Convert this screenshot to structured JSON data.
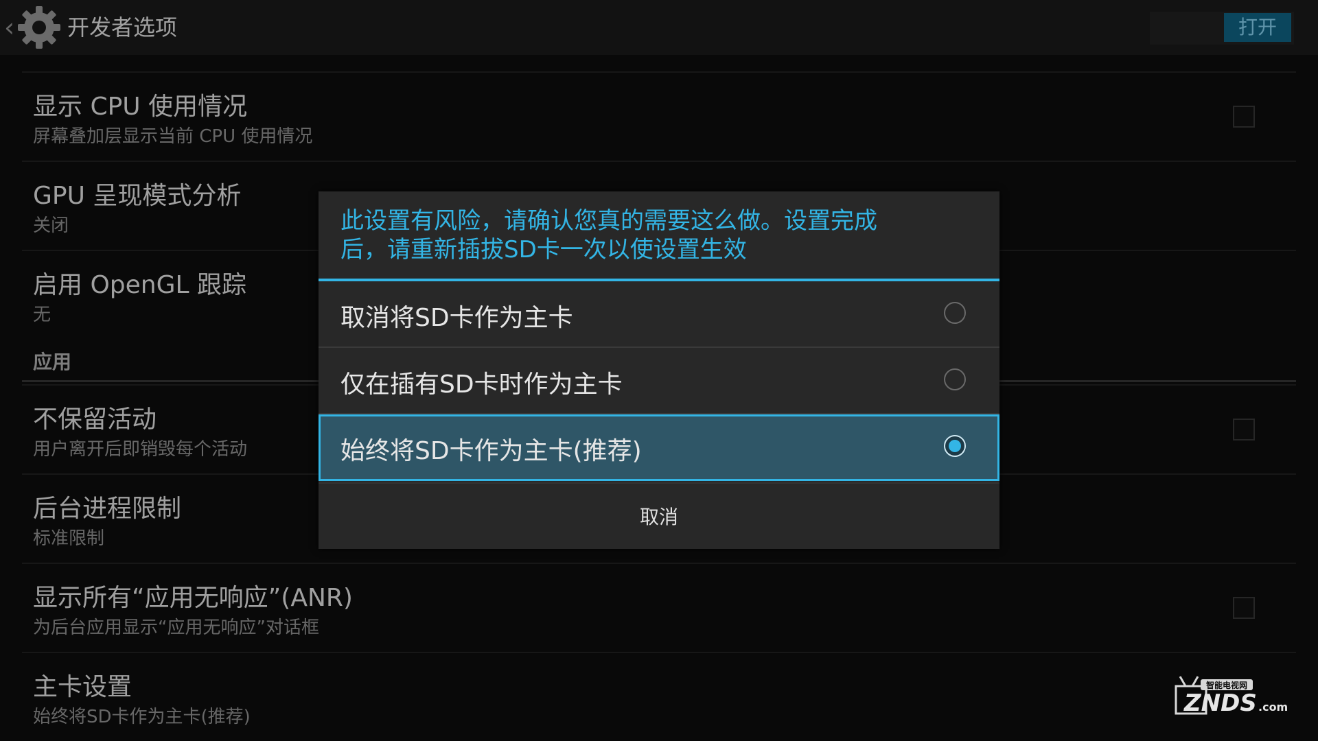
{
  "action_bar": {
    "title": "开发者选项",
    "switch_label": "打开",
    "back_icon": "chevron-left-icon",
    "app_icon": "gear-icon"
  },
  "preferences": [
    {
      "title": "显示 CPU 使用情况",
      "summary": "屏幕叠加层显示当前 CPU 使用情况",
      "checkbox": true,
      "checked": false
    },
    {
      "title": "GPU 呈现模式分析",
      "summary": "关闭",
      "checkbox": false
    },
    {
      "title": "启用 OpenGL 跟踪",
      "summary": "无",
      "checkbox": false
    }
  ],
  "category_apps": "应用",
  "preferences_apps": [
    {
      "title": "不保留活动",
      "summary": "用户离开后即销毁每个活动",
      "checkbox": true,
      "checked": false
    },
    {
      "title": "后台进程限制",
      "summary": "标准限制",
      "checkbox": false
    },
    {
      "title": "显示所有“应用无响应”(ANR)",
      "summary": "为后台应用显示“应用无响应”对话框",
      "checkbox": true,
      "checked": false
    },
    {
      "title": "主卡设置",
      "summary": "始终将SD卡作为主卡(推荐)",
      "checkbox": false
    }
  ],
  "dialog": {
    "title_line1": "此设置有风险，请确认您真的需要这么做。设置完成",
    "title_line2": "后，请重新插拔SD卡一次以使设置生效",
    "options": [
      {
        "label": "取消将SD卡作为主卡",
        "selected": false
      },
      {
        "label": "仅在插有SD卡时作为主卡",
        "selected": false
      },
      {
        "label": "始终将SD卡作为主卡(推荐)",
        "selected": true
      }
    ],
    "cancel_label": "取消"
  },
  "watermark": {
    "brand": "ZNDS",
    "domain": ".com",
    "tagline": "智能电视网"
  },
  "colors": {
    "accent": "#33b5e5",
    "selected_bg": "#2f5667",
    "dialog_bg": "#282828",
    "background": "#0c0c0c"
  }
}
